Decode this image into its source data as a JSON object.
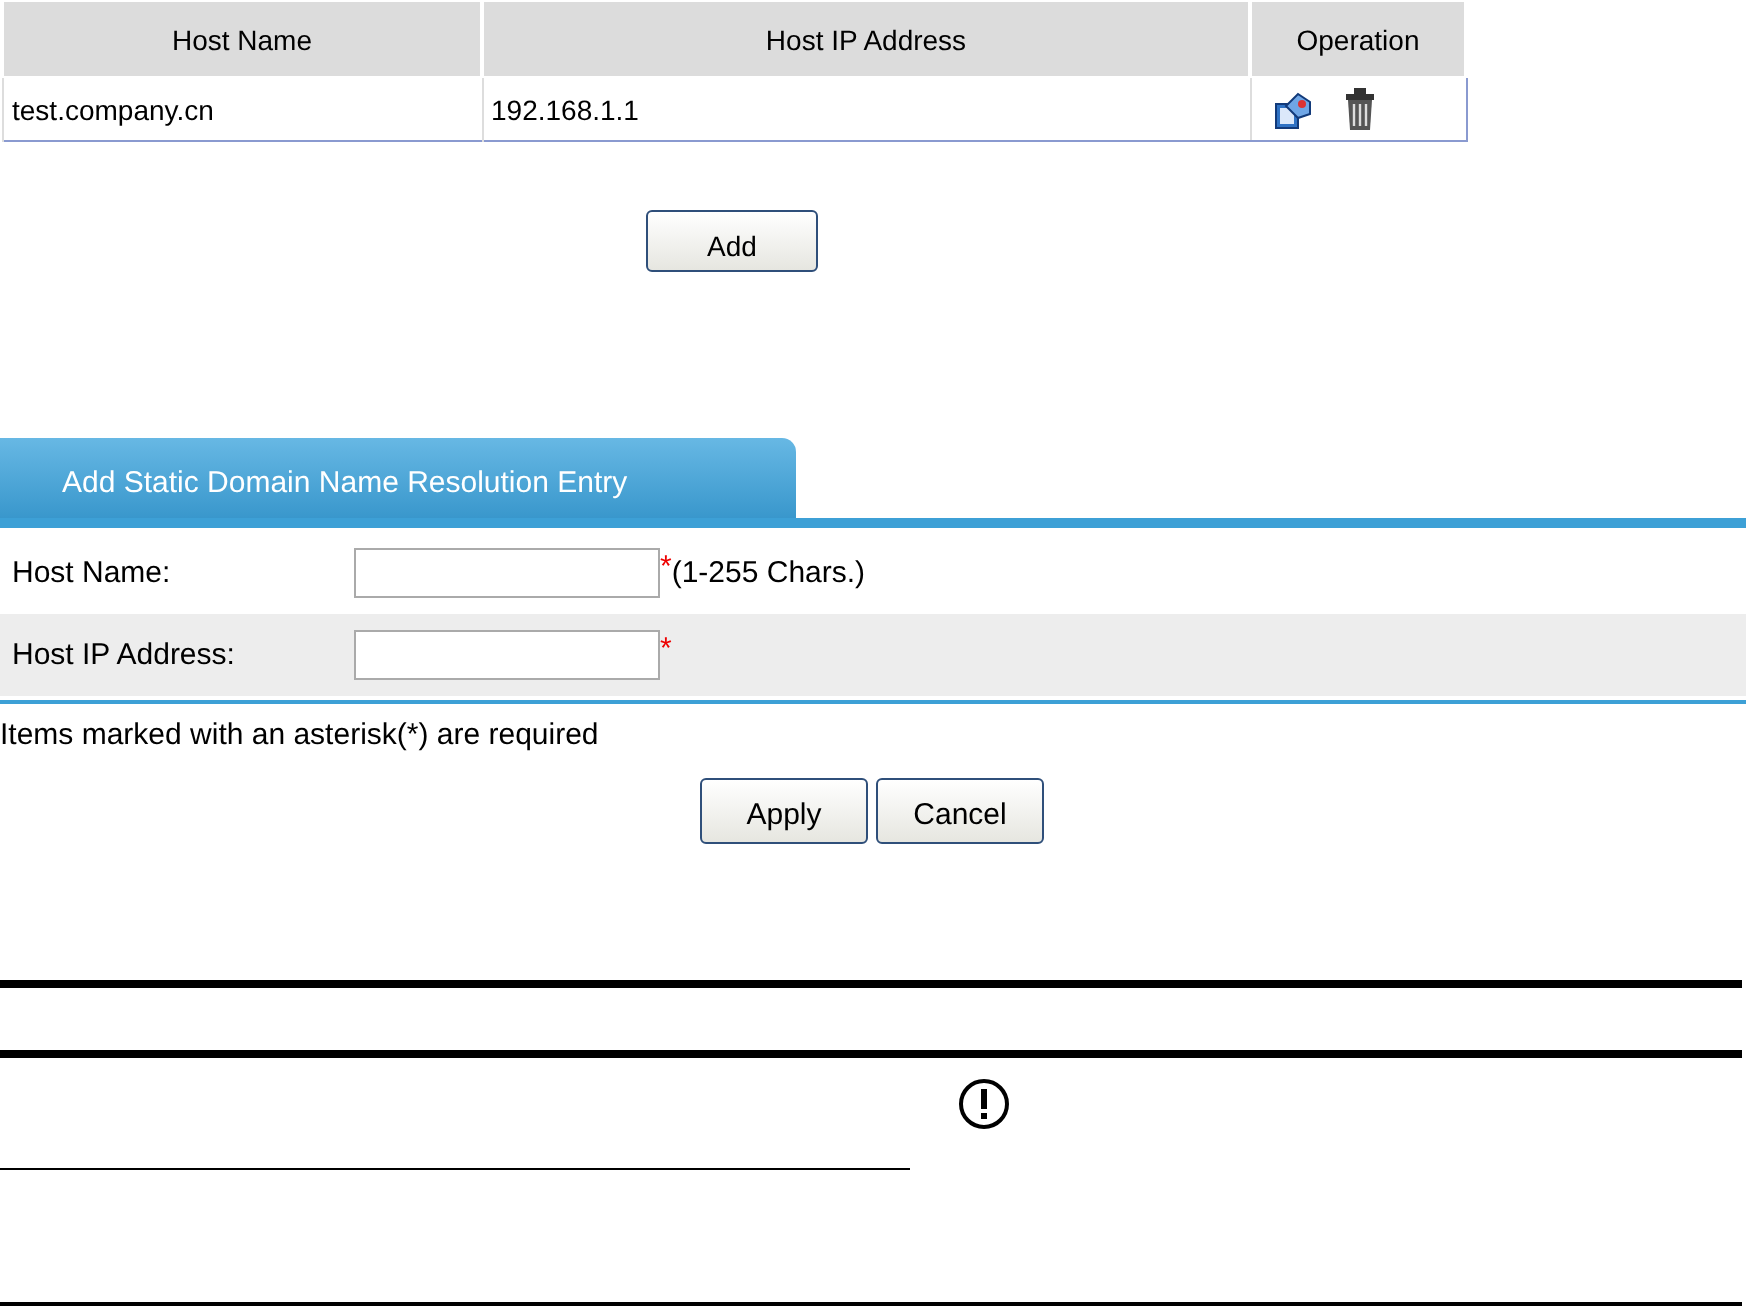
{
  "table": {
    "columns": [
      "Host Name",
      "Host IP Address",
      "Operation"
    ],
    "rows": [
      {
        "host_name": "test.company.cn",
        "host_ip": "192.168.1.1"
      }
    ]
  },
  "add_button": "Add",
  "form": {
    "tab": {
      "label": "Add Static Domain Name Resolution Entry",
      "selected": true
    },
    "fields": [
      {
        "label": "Host Name:",
        "required_mark": "*",
        "hint": "(1-255 Chars.)"
      },
      {
        "label": "Host IP Address:",
        "required_mark": "*"
      }
    ],
    "note": "Items marked with an asterisk(*) are required",
    "buttons": [
      "Apply",
      "Cancel"
    ]
  }
}
